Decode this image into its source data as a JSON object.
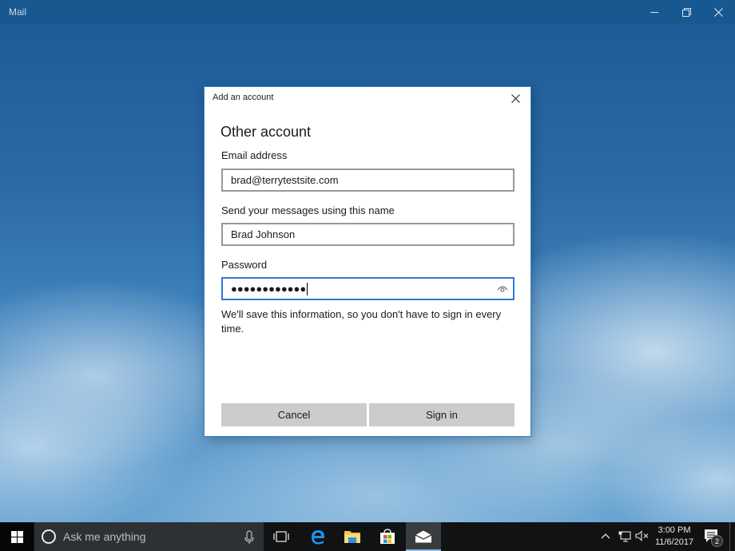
{
  "window": {
    "title": "Mail",
    "controls": {
      "minimize": "minimize",
      "maximize": "restore",
      "close": "close"
    }
  },
  "dialog": {
    "header_title": "Add an account",
    "heading": "Other account",
    "fields": {
      "email": {
        "label": "Email address",
        "value": "brad@terrytestsite.com"
      },
      "display_name": {
        "label": "Send your messages using this name",
        "value": "Brad Johnson"
      },
      "password": {
        "label": "Password",
        "masked_value": "●●●●●●●●●●●●",
        "reveal_icon": "eye-icon"
      }
    },
    "info_text": "We'll save this information, so you don't have to sign in every time.",
    "buttons": {
      "cancel": "Cancel",
      "sign_in": "Sign in"
    }
  },
  "taskbar": {
    "search_placeholder": "Ask me anything",
    "pinned": [
      {
        "name": "Task View",
        "icon": "task-view-icon"
      },
      {
        "name": "Microsoft Edge",
        "icon": "edge-icon"
      },
      {
        "name": "File Explorer",
        "icon": "folder-icon"
      },
      {
        "name": "Store",
        "icon": "store-icon"
      },
      {
        "name": "Mail",
        "icon": "mail-icon",
        "active": true
      }
    ],
    "tray": {
      "time": "3:00 PM",
      "date": "11/6/2017",
      "notification_count": "2"
    }
  },
  "colors": {
    "titlebar": "#175891",
    "dialog_border": "#3a88d0",
    "focus_border": "#2b7cd3",
    "button_bg": "#cccccc",
    "taskbar": "#101214"
  }
}
